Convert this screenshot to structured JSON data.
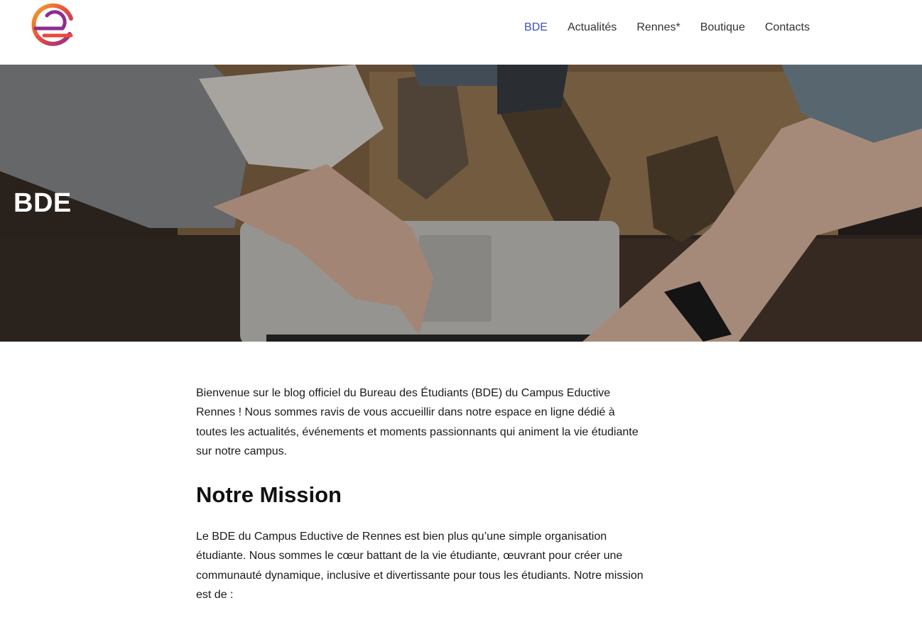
{
  "header": {
    "logo_icon": "brand-e-logo-icon",
    "nav": [
      {
        "label": "BDE",
        "active": true
      },
      {
        "label": "Actualités",
        "active": false
      },
      {
        "label": "Rennes*",
        "active": false
      },
      {
        "label": "Boutique",
        "active": false
      },
      {
        "label": "Contacts",
        "active": false
      }
    ]
  },
  "hero": {
    "title": "BDE"
  },
  "content": {
    "intro": "Bienvenue sur le blog officiel du Bureau des Étudiants (BDE) du Campus Eductive Rennes ! Nous sommes ravis de vous accueillir dans notre espace en ligne dédié à toutes les actualités, événements et moments passionnants qui animent la vie étudiante sur notre campus.",
    "mission_heading": "Notre Mission",
    "mission_text": "Le BDE du Campus Eductive de Rennes est bien plus qu’une simple organisation étudiante. Nous sommes le cœur battant de la vie étudiante, œuvrant pour créer une communauté dynamique, inclusive et divertissante pour tous les étudiants. Notre mission est de :"
  },
  "colors": {
    "nav_active": "#3f51b5",
    "nav_default": "#333333",
    "text": "#1a1a1a"
  }
}
